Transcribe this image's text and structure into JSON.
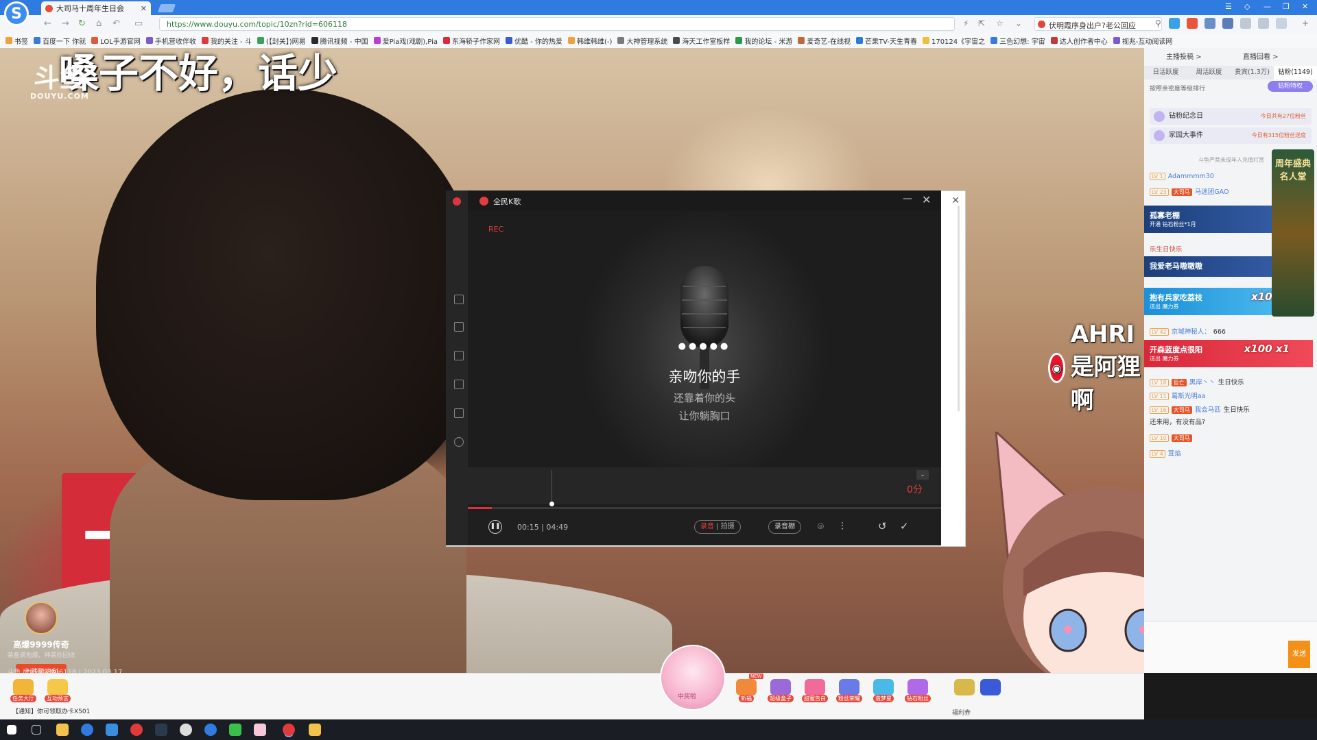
{
  "browser": {
    "tab_title": "大司马十周年生日会",
    "address": "https://www.douyu.com/topic/10zn?rid=606118",
    "search_text": "伏明霞序身出户?老公回应",
    "bookmarks": [
      "书签",
      "百度一下 你就",
      "LOL手游官网",
      "手机营收伴收",
      "我的关注 - 斗",
      "(【封关】)网易",
      "腾讯视频 - 中国",
      "爱Pia戏(戏剧),Pia",
      "东海轿子作家网",
      "优酷 - 你的热爱",
      "韩维韩维(-)",
      "大神管理系统",
      "海天工作室板样",
      "我的论坛 - 米游",
      "爱奇艺-在线视",
      "芒果TV-天生青春",
      "170124《宇宙之",
      "三色幻想: 宇宙",
      "达人创作者中心",
      "视兆-互动阅读网"
    ]
  },
  "stream": {
    "caption": "嗓子不好，话少",
    "watermark_logo": "斗鱼",
    "watermark_domain": "DOUYU.COM",
    "room_info": "斗鱼 房间号：606118 | 2023.03.17",
    "banner_char": "十",
    "promo": {
      "title": "高爆9999传奇",
      "desc": "装备满地爆，神装秒回收",
      "button": "上线领福利"
    },
    "weibo_handle": "AHRI是阿狸啊"
  },
  "karaoke": {
    "title": "全民K歌",
    "rec": "REC",
    "dots": "●●●●●",
    "lyrics": [
      "亲吻你的手",
      "还靠着你的头",
      "让你躺胸口"
    ],
    "score": "0分",
    "time_current": "00:15",
    "time_total": "04:49",
    "mode_record": "录音",
    "mode_video": "拍摄",
    "tune_label": "录音棚",
    "progress": 0.05
  },
  "sidebar": {
    "top_left": "主播投稿 >",
    "top_right": "直播回看 >",
    "tabs": [
      "日活跃度",
      "周活跃度",
      "贵宾(1.3万)",
      "钻粉(1149)"
    ],
    "rank_note": "按照亲密度等级排行",
    "privilege": "钻粉特权",
    "card1": "钻粉纪念日",
    "card1_right": "今日共有27位粉丝",
    "card2": "家园大事件",
    "card2_right": "今日有315位粉丝送度",
    "rule_note": "斗鱼严禁未成年人充值打赏",
    "vertical_gift": "周年盛典名人堂",
    "chat": [
      {
        "lv": "LV 1",
        "nick": "Adammmm30",
        "text": ""
      },
      {
        "lv": "LV 23",
        "badge": "大司马",
        "nick": "马迷团GAO",
        "text": ""
      },
      {
        "lv": "LV 18",
        "badge": "巨亡",
        "nick": "黑岸丶丶",
        "text": "生日快乐"
      },
      {
        "lv": "LV 11",
        "nick": "葛斯光明aa",
        "text": ""
      },
      {
        "lv": "LV 16",
        "badge": "大司马",
        "nick": "我会马匹",
        "text": "生日快乐"
      },
      {
        "lv": "",
        "nick": "",
        "text": "还来用，有没有品?"
      },
      {
        "lv": "LV 10",
        "badge": "大司马",
        "nick": "",
        "text": ""
      },
      {
        "lv": "LV 4",
        "nick": "茸焰",
        "text": ""
      }
    ],
    "gift_banners": [
      {
        "name": "孤寡老棚",
        "sub": "开通  钻石粉丝*1月",
        "extra": "乐生日快乐"
      },
      {
        "name": "我爱老马嗷嗷嗷",
        "sub": "",
        "extra": ""
      },
      {
        "name": "抱有兵家吃荔枝",
        "sub": "送出  魔力券",
        "count": "x10 x1"
      },
      {
        "name": "开森蓝度点很阳",
        "sub": "送出  魔力券",
        "count": "x100 x1"
      }
    ],
    "user_line": "京城神秘人：",
    "user_line_num": "666",
    "send": "发送"
  },
  "giftbar": {
    "left_items": [
      "任务大厅",
      "互动预言"
    ],
    "notice": "【通知】你可领取办卡X501",
    "right_items": [
      "新福",
      "超级盒子",
      "甜蜜告白",
      "粉丝荣耀",
      "造梦星",
      "钻石粉丝"
    ],
    "new_tag": "NEW",
    "welfare": "福利券",
    "bowl_label": "中奖啦"
  },
  "colors": {
    "browser_blue": "#2f7be0",
    "karaoke_red": "#e23c3c",
    "douyu_orange": "#f39017"
  }
}
